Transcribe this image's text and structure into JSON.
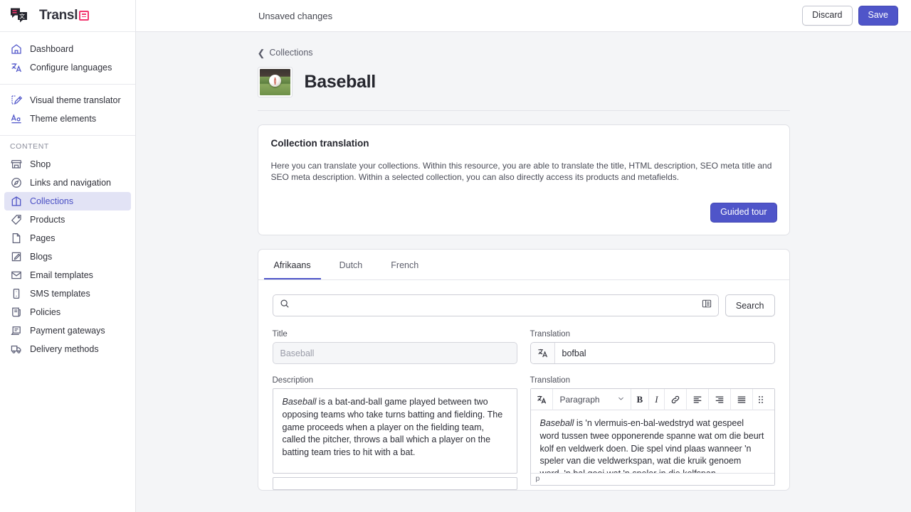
{
  "brand": {
    "name": "Transl",
    "badge_icon": "grid-badge-icon",
    "badge_color": "#f2376f"
  },
  "sidebar": {
    "top_items": [
      {
        "label": "Dashboard",
        "icon": "home-icon"
      },
      {
        "label": "Configure languages",
        "icon": "translate-icon"
      }
    ],
    "theme_items": [
      {
        "label": "Visual theme translator",
        "icon": "theme-edit-icon"
      },
      {
        "label": "Theme elements",
        "icon": "font-aa-icon"
      }
    ],
    "content_section_title": "CONTENT",
    "content_items": [
      {
        "label": "Shop",
        "icon": "store-icon",
        "active": false
      },
      {
        "label": "Links and navigation",
        "icon": "compass-icon",
        "active": false
      },
      {
        "label": "Collections",
        "icon": "collection-icon",
        "active": true
      },
      {
        "label": "Products",
        "icon": "tag-icon",
        "active": false
      },
      {
        "label": "Pages",
        "icon": "page-icon",
        "active": false
      },
      {
        "label": "Blogs",
        "icon": "blog-edit-icon",
        "active": false
      },
      {
        "label": "Email templates",
        "icon": "envelope-icon",
        "active": false
      },
      {
        "label": "SMS templates",
        "icon": "phone-icon",
        "active": false
      },
      {
        "label": "Policies",
        "icon": "policy-scroll-icon",
        "active": false
      },
      {
        "label": "Payment gateways",
        "icon": "payment-card-icon",
        "active": false
      },
      {
        "label": "Delivery methods",
        "icon": "truck-icon",
        "active": false
      }
    ]
  },
  "topbar": {
    "status": "Unsaved changes",
    "discard_label": "Discard",
    "save_label": "Save",
    "save_color": "#4f55c9"
  },
  "breadcrumb": {
    "back_icon": "chevron-left-icon",
    "label": "Collections"
  },
  "page": {
    "title": "Baseball",
    "thumbnail": "baseball-thumbnail"
  },
  "info_card": {
    "title": "Collection translation",
    "description": "Here you can translate your collections. Within this resource, you are able to translate the title, HTML description, SEO meta title and SEO meta description. Within a selected collection, you can also directly access its products and metafields.",
    "guided_tour_label": "Guided tour"
  },
  "tabs": [
    {
      "label": "Afrikaans",
      "active": true
    },
    {
      "label": "Dutch",
      "active": false
    },
    {
      "label": "French",
      "active": false
    }
  ],
  "search": {
    "icon": "search-icon",
    "value": "",
    "placeholder": "",
    "list_icon": "list-view-icon",
    "button_label": "Search"
  },
  "fields": {
    "title_label": "Title",
    "title_value": "Baseball",
    "title_translation_label": "Translation",
    "title_translation_value": "bofbal",
    "translate_icon": "translate-icon",
    "description_label": "Description",
    "description_lead_italic": "Baseball",
    "description_rest": " is a bat-and-ball game played between two opposing teams who take turns batting and fielding. The game proceeds when a player on the fielding team, called the pitcher, throws a ball which a player on the batting team tries to hit with a bat.",
    "description_translation_label": "Translation",
    "translation_lead_italic": "Baseball",
    "translation_rest": " is 'n vlermuis-en-bal-wedstryd wat gespeel word tussen twee opponerende spanne wat om die beurt kolf en veldwerk doen. Die spel vind plaas wanneer 'n speler van die veldwerkspan, wat die kruik genoem word, 'n bal gooi wat 'n speler in die kolfspan"
  },
  "editor": {
    "translate_icon": "translate-icon",
    "block_format": "Paragraph",
    "chevron_icon": "chevron-down-icon",
    "bold_label": "B",
    "italic_label": "I",
    "link_icon": "link-icon",
    "align_left_icon": "align-left-icon",
    "align_right_icon": "align-right-icon",
    "align_justify_icon": "align-justify-icon",
    "grip_icon": "drag-grip-icon",
    "status": "p"
  }
}
